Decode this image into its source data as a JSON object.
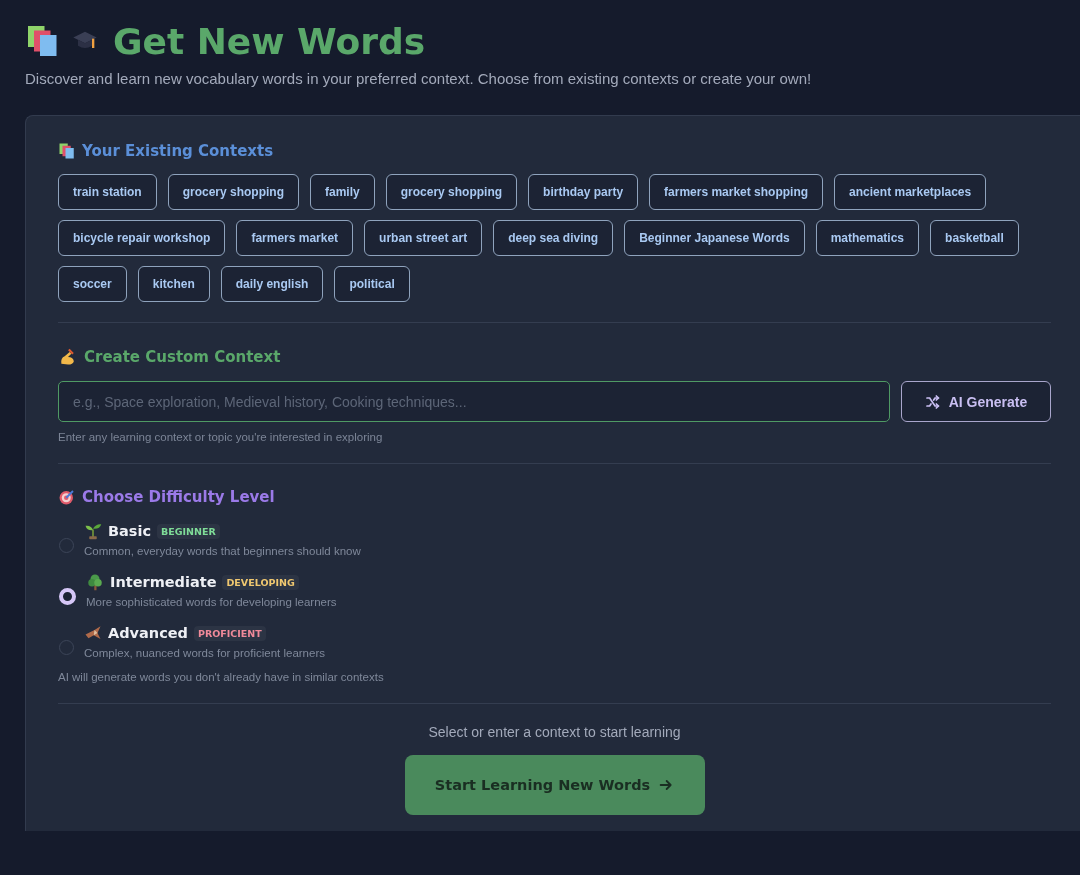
{
  "header": {
    "title": "Get New Words",
    "subtitle": "Discover and learn new vocabulary words in your preferred context. Choose from existing contexts or create your own!"
  },
  "existing_contexts": {
    "heading": "Your Existing Contexts",
    "chips": [
      "train station",
      "grocery shopping",
      "family",
      "grocery shopping",
      "birthday party",
      "farmers market shopping",
      "ancient marketplaces",
      "bicycle repair workshop",
      "farmers market",
      "urban street art",
      "deep sea diving",
      "Beginner Japanese Words",
      "mathematics",
      "basketball",
      "soccer",
      "kitchen",
      "daily english",
      "political"
    ]
  },
  "custom_context": {
    "heading": "Create Custom Context",
    "placeholder": "e.g., Space exploration, Medieval history, Cooking techniques...",
    "button": "AI Generate",
    "hint": "Enter any learning context or topic you're interested in exploring"
  },
  "difficulty": {
    "heading": "Choose Difficulty Level",
    "levels": [
      {
        "name": "Basic",
        "badge": "BEGINNER",
        "color": "#7fdc98",
        "description": "Common, everyday words that beginners should know",
        "selected": false
      },
      {
        "name": "Intermediate",
        "badge": "DEVELOPING",
        "color": "#f0c870",
        "description": "More sophisticated words for developing learners",
        "selected": true
      },
      {
        "name": "Advanced",
        "badge": "PROFICIENT",
        "color": "#f08a9a",
        "description": "Complex, nuanced words for proficient learners",
        "selected": false
      }
    ],
    "note": "AI will generate words you don't already have in similar contexts"
  },
  "footer": {
    "status": "Select or enter a context to start learning",
    "button": {
      "label": "Start Learning New Words",
      "disabled": true
    }
  }
}
